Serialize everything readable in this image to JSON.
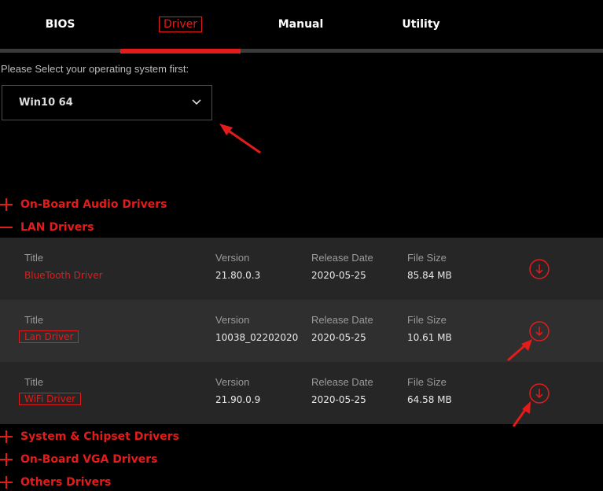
{
  "tabs": [
    {
      "label": "BIOS"
    },
    {
      "label": "Driver"
    },
    {
      "label": "Manual"
    },
    {
      "label": "Utility"
    }
  ],
  "os_select": {
    "prompt": "Please Select your operating system first:",
    "selected": "Win10 64"
  },
  "categories": [
    {
      "label": "On-Board Audio Drivers",
      "expanded": false
    },
    {
      "label": "LAN Drivers",
      "expanded": true
    },
    {
      "label": "System & Chipset Drivers",
      "expanded": false
    },
    {
      "label": "On-Board VGA Drivers",
      "expanded": false
    },
    {
      "label": "Others Drivers",
      "expanded": false
    }
  ],
  "columns": {
    "title": "Title",
    "version": "Version",
    "release_date": "Release Date",
    "file_size": "File Size"
  },
  "drivers": [
    {
      "title": "BlueTooth Driver",
      "version": "21.80.0.3",
      "release_date": "2020-05-25",
      "file_size": "85.84 MB"
    },
    {
      "title": "Lan Driver",
      "version": "10038_02202020",
      "release_date": "2020-05-25",
      "file_size": "10.61 MB"
    },
    {
      "title": "WiFi Driver",
      "version": "21.90.0.9",
      "release_date": "2020-05-25",
      "file_size": "64.58 MB"
    }
  ],
  "colors": {
    "accent": "#e41b1b",
    "background": "#000000",
    "row_dark": "#262626",
    "row_light": "#2f2f2f"
  },
  "icons": {
    "select_chevron": "chevron-down-icon",
    "download": "download-circle-icon",
    "collapsed": "plus-icon",
    "expanded": "minus-icon"
  }
}
